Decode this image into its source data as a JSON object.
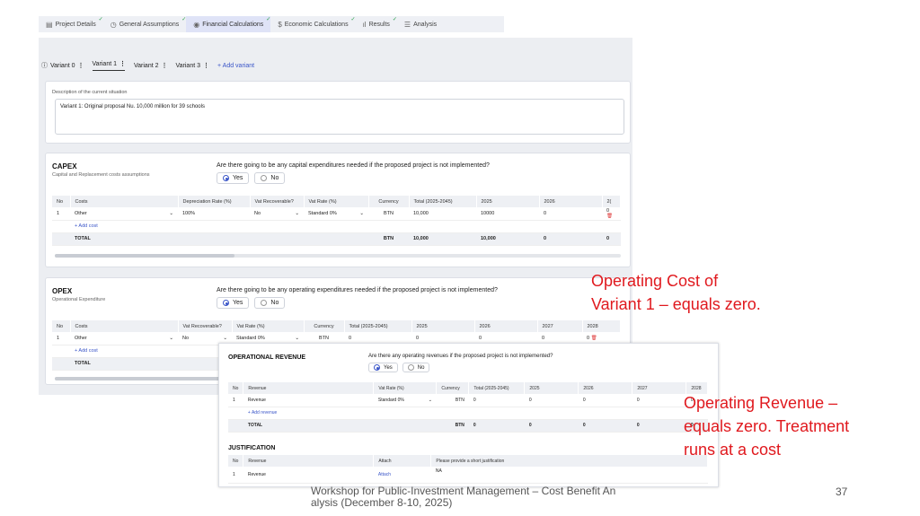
{
  "tabs": [
    {
      "label": "Project Details",
      "icon": "document-icon",
      "done": true
    },
    {
      "label": "General Assumptions",
      "icon": "clock-icon",
      "done": true
    },
    {
      "label": "Financial Calculations",
      "icon": "target-icon",
      "done": true
    },
    {
      "label": "Economic Calculations",
      "icon": "coin-icon",
      "done": true
    },
    {
      "label": "Results",
      "icon": "bar-chart-icon",
      "done": true
    },
    {
      "label": "Analysis",
      "icon": "sliders-icon",
      "done": false
    }
  ],
  "variants": {
    "items": [
      "Variant 0",
      "Variant 1",
      "Variant 2",
      "Variant 3"
    ],
    "selected": "Variant 1",
    "add_label": "+ Add variant"
  },
  "description": {
    "label": "Description of the current situation",
    "value": "Variant 1: Original proposal Nu. 10,000 million for 39 schools"
  },
  "capex": {
    "title": "CAPEX",
    "subtitle": "Capital and Replacement costs assumptions",
    "question": "Are there going to be any capital expenditures needed if the proposed project is not implemented?",
    "yes": "Yes",
    "no": "No",
    "headers": [
      "No",
      "Costs",
      "Depreciation Rate (%)",
      "Vat Recoverable?",
      "Vat Rate (%)",
      "Currency",
      "Total (2025-2045)",
      "2025",
      "2026",
      "2("
    ],
    "row": [
      "1",
      "Other",
      "100%",
      "No",
      "Standard 0%",
      "BTN",
      "10,000",
      "10000",
      "0",
      "0"
    ],
    "add": "+ Add cost",
    "total": [
      "TOTAL",
      "BTN",
      "10,000",
      "10,000",
      "0",
      "0"
    ]
  },
  "opex": {
    "title": "OPEX",
    "subtitle": "Operational Expenditure",
    "question": "Are there going to be any operating expenditures needed if the proposed project is not implemented?",
    "yes": "Yes",
    "no": "No",
    "headers": [
      "No",
      "Costs",
      "Vat Recoverable?",
      "Vat Rate (%)",
      "Currency",
      "Total (2025-2045)",
      "2025",
      "2026",
      "2027",
      "2028"
    ],
    "row": [
      "1",
      "Other",
      "No",
      "Standard 0%",
      "BTN",
      "0",
      "0",
      "0",
      "0",
      "0"
    ],
    "add": "+ Add cost",
    "total": "TOTAL"
  },
  "revenue": {
    "title": "OPERATIONAL REVENUE",
    "question": "Are there any operating revenues if the proposed project is not implemented?",
    "yes": "Yes",
    "no": "No",
    "headers": [
      "No",
      "Revenue",
      "Vat Rate (%)",
      "Currency",
      "Total (2025-2045)",
      "2025",
      "2026",
      "2027",
      "2028"
    ],
    "row": [
      "1",
      "Revenue",
      "Standard 0%",
      "BTN",
      "0",
      "0",
      "0",
      "0",
      "0"
    ],
    "add": "+ Add revenue",
    "total": [
      "TOTAL",
      "BTN",
      "0",
      "0",
      "0",
      "0",
      "0"
    ]
  },
  "justification": {
    "title": "JUSTIFICATION",
    "headers": [
      "No",
      "Revenue",
      "Attach",
      "Please provide a short justification"
    ],
    "row": [
      "1",
      "Revenue",
      "Attach",
      "NA"
    ]
  },
  "annotations": {
    "opex": [
      "Operating Cost of",
      "Variant 1 – equals zero."
    ],
    "revenue": [
      "Operating Revenue –",
      "equals zero. Treatment",
      "runs at a cost"
    ]
  },
  "footer": {
    "text": "Workshop for Public-Investment Management – Cost Benefit Analysis (December 8-10, 2025)",
    "page": "37"
  },
  "colors": {
    "accent": "#3a55c8",
    "annotation": "#e0191e",
    "check": "#2aa04a"
  }
}
